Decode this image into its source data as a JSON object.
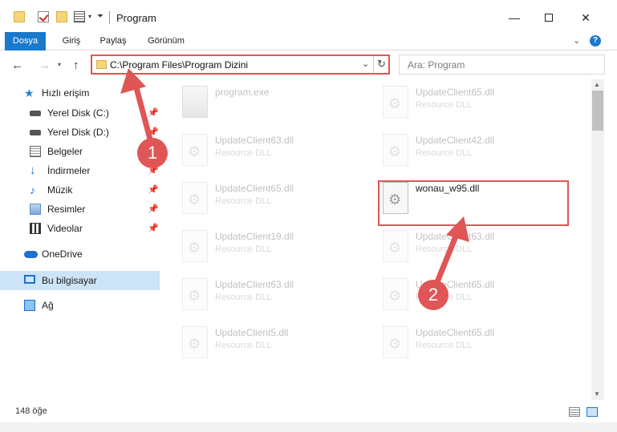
{
  "window": {
    "title": "Program",
    "minimize_glyph": "—",
    "close_glyph": "✕"
  },
  "ribbon": {
    "tabs": [
      {
        "label": "Dosya",
        "active": true
      },
      {
        "label": "Giriş"
      },
      {
        "label": "Paylaş"
      },
      {
        "label": "Görünüm"
      }
    ],
    "help_glyph": "?"
  },
  "address_bar": {
    "path": "C:\\Program Files\\Program Dizini",
    "search_placeholder": "Ara: Program"
  },
  "navigation_pane": {
    "items": [
      {
        "label": "Hızlı erişim",
        "icon": "star-icon"
      },
      {
        "label": "Yerel Disk (C:)",
        "icon": "disk-icon",
        "pinned": true
      },
      {
        "label": "Yerel Disk (D:)",
        "icon": "disk-icon",
        "pinned": true
      },
      {
        "label": "Belgeler",
        "icon": "document-icon",
        "pinned": true
      },
      {
        "label": "İndirmeler",
        "icon": "download-icon",
        "pinned": true
      },
      {
        "label": "Müzik",
        "icon": "music-icon",
        "pinned": true
      },
      {
        "label": "Resimler",
        "icon": "pictures-icon",
        "pinned": true
      },
      {
        "label": "Videolar",
        "icon": "video-icon",
        "pinned": true
      },
      {
        "label": "OneDrive",
        "icon": "cloud-icon"
      },
      {
        "label": "Bu bilgisayar",
        "icon": "computer-icon",
        "selected": true
      },
      {
        "label": "Ağ",
        "icon": "network-icon"
      }
    ]
  },
  "files": [
    {
      "name": "program.exe",
      "type": ""
    },
    {
      "name": "UpdateClient65.dll",
      "type": "Resource DLL"
    },
    {
      "name": "UpdateClient63.dll",
      "type": "Resource DLL"
    },
    {
      "name": "UpdateClient42.dll",
      "type": "Resource DLL"
    },
    {
      "name": "UpdateClient65.dll",
      "type": "Resource DLL"
    },
    {
      "name": "wonau_w95.dll",
      "type": ""
    },
    {
      "name": "UpdateClient19.dll",
      "type": "Resource DLL"
    },
    {
      "name": "UpdateClient63.dll",
      "type": "Resource DLL"
    },
    {
      "name": "UpdateClient63.dll",
      "type": "Resource DLL"
    },
    {
      "name": "UpdateClient65.dll",
      "type": "Resource DLL"
    },
    {
      "name": "UpdateClient5.dll",
      "type": "Resource DLL"
    },
    {
      "name": "UpdateClient65.dll",
      "type": "Resource DLL"
    }
  ],
  "status_bar": {
    "item_count": "148 öğe"
  },
  "annotations": {
    "step1": "1",
    "step2": "2",
    "color": "#e05555"
  },
  "colors": {
    "accent": "#1979ca",
    "selection": "#cce4f7"
  }
}
